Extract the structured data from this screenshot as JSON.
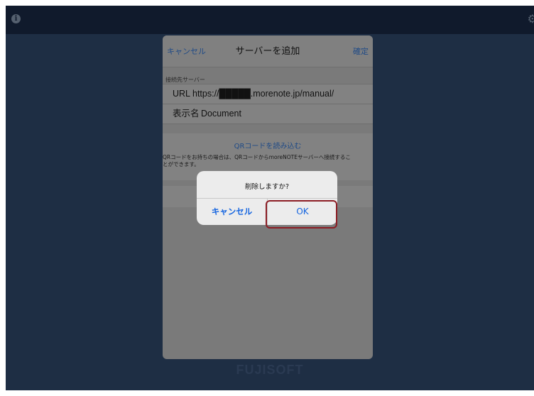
{
  "topbar": {
    "info_icon": "info-icon",
    "gear_icon": "gear-icon"
  },
  "background": {
    "brand": "FUJISOFT"
  },
  "sheet": {
    "cancel_label": "キャンセル",
    "title": "サーバーを追加",
    "confirm_label": "確定",
    "section_label": "接続先サーバー",
    "url_label": "URL",
    "url_value": "https://█████.morenote.jp/manual/",
    "name_label": "表示名",
    "name_value": "Document",
    "qr_link": "QRコードを読み込む",
    "qr_desc_line1": "QRコードをお持ちの場合は、QRコードからmoreNOTEサーバーへ接続するこ",
    "qr_desc_line2": "とができます。"
  },
  "alert": {
    "message": "削除しますか?",
    "cancel_label": "キャンセル",
    "ok_label": "OK"
  },
  "colors": {
    "background": "#1e2e44",
    "topbar": "#101a2c",
    "link": "#1565e0",
    "highlight": "#8c1d24"
  }
}
